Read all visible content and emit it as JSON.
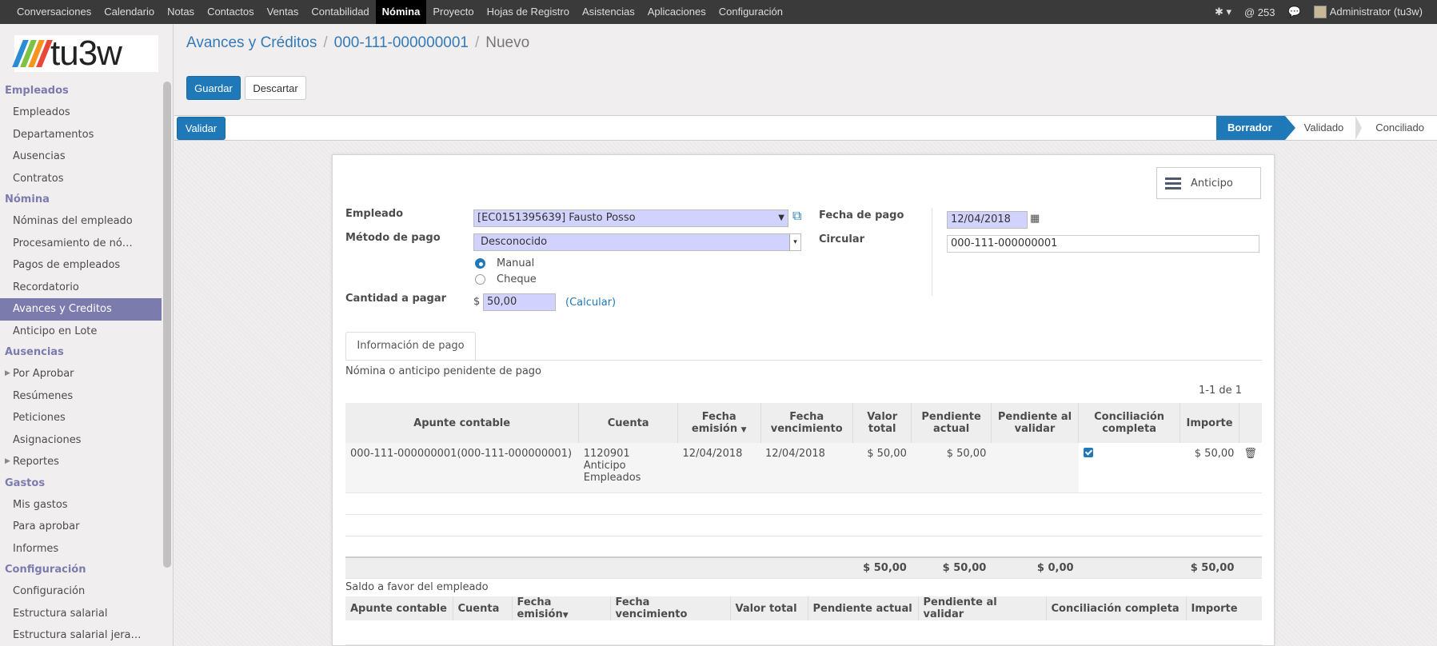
{
  "topnav": {
    "items": [
      "Conversaciones",
      "Calendario",
      "Notas",
      "Contactos",
      "Ventas",
      "Contabilidad",
      "Nómina",
      "Proyecto",
      "Hojas de Registro",
      "Asistencias",
      "Aplicaciones",
      "Configuración"
    ],
    "active": "Nómina",
    "bug_icon": "bug-icon",
    "mentions": "@ 253",
    "user": "Administrator (tu3w)"
  },
  "logo": {
    "text": "tu3w",
    "stripe_colors": [
      "#2a8dd4",
      "#7dc242",
      "#f7941d",
      "#e8473b"
    ]
  },
  "sidebar": {
    "sections": [
      {
        "title": "Empleados",
        "items": [
          "Empleados",
          "Departamentos",
          "Ausencias",
          "Contratos"
        ]
      },
      {
        "title": "Nómina",
        "items": [
          "Nóminas del empleado",
          "Procesamiento de nó…",
          "Pagos de empleados",
          "Recordatorio",
          "Avances y Creditos",
          "Anticipo en Lote"
        ]
      },
      {
        "title": "Ausencias",
        "items": [
          "Por Aprobar",
          "Resúmenes",
          "Peticiones",
          "Asignaciones",
          "Reportes"
        ]
      },
      {
        "title": "Gastos",
        "items": [
          "Mis gastos",
          "Para aprobar",
          "Informes"
        ]
      },
      {
        "title": "Configuración",
        "items": [
          "Configuración",
          "Estructura salarial",
          "Estructura salarial jera…"
        ]
      }
    ],
    "active_item": "Avances y Creditos",
    "expandable_items": [
      "Por Aprobar",
      "Reportes"
    ]
  },
  "breadcrumb": {
    "parent": "Avances y Créditos",
    "record": "000-111-000000001",
    "current": "Nuevo",
    "separator": "/"
  },
  "actions": {
    "save": "Guardar",
    "discard": "Descartar"
  },
  "statusbar": {
    "validate": "Validar",
    "stages": [
      "Borrador",
      "Validado",
      "Conciliado"
    ],
    "current_stage": "Borrador"
  },
  "form": {
    "smart_button": "Anticipo",
    "employee_label": "Empleado",
    "employee_value": "[EC0151395639] Fausto Posso",
    "method_label": "Método de pago",
    "method_value": "Desconocido",
    "radio_options": [
      "Manual",
      "Cheque"
    ],
    "radio_selected": "Manual",
    "amount_label": "Cantidad a pagar",
    "currency": "$",
    "amount_value": "50,00",
    "calc_link": "(Calcular)",
    "date_label": "Fecha de pago",
    "date_value": "12/04/2018",
    "circular_label": "Circular",
    "circular_value": "000-111-000000001"
  },
  "tab": {
    "label": "Información de pago"
  },
  "pending": {
    "title": "Nómina o anticipo penidente de pago",
    "pager": "1-1 de 1",
    "headers": [
      "Apunte contable",
      "Cuenta",
      "Fecha emisión",
      "Fecha vencimiento",
      "Valor total",
      "Pendiente actual",
      "Pendiente al validar",
      "Conciliación completa",
      "Importe"
    ],
    "rows": [
      {
        "apunte": "000-111-000000001(000-111-000000001)",
        "cuenta": "1120901 Anticipo Empleados",
        "emision": "12/04/2018",
        "vencimiento": "12/04/2018",
        "valor": "$ 50,00",
        "pendiente": "$ 50,00",
        "pendiente_validar": "",
        "conciliacion": true,
        "importe": "$ 50,00"
      }
    ],
    "totals": {
      "valor": "$ 50,00",
      "pendiente": "$ 50,00",
      "pendiente_validar": "$ 0,00",
      "importe": "$ 50,00"
    }
  },
  "balance": {
    "title": "Saldo a favor del empleado",
    "headers": [
      "Apunte contable",
      "Cuenta",
      "Fecha emisión",
      "Fecha vencimiento",
      "Valor total",
      "Pendiente actual",
      "Pendiente al validar",
      "Conciliación completa",
      "Importe"
    ]
  }
}
